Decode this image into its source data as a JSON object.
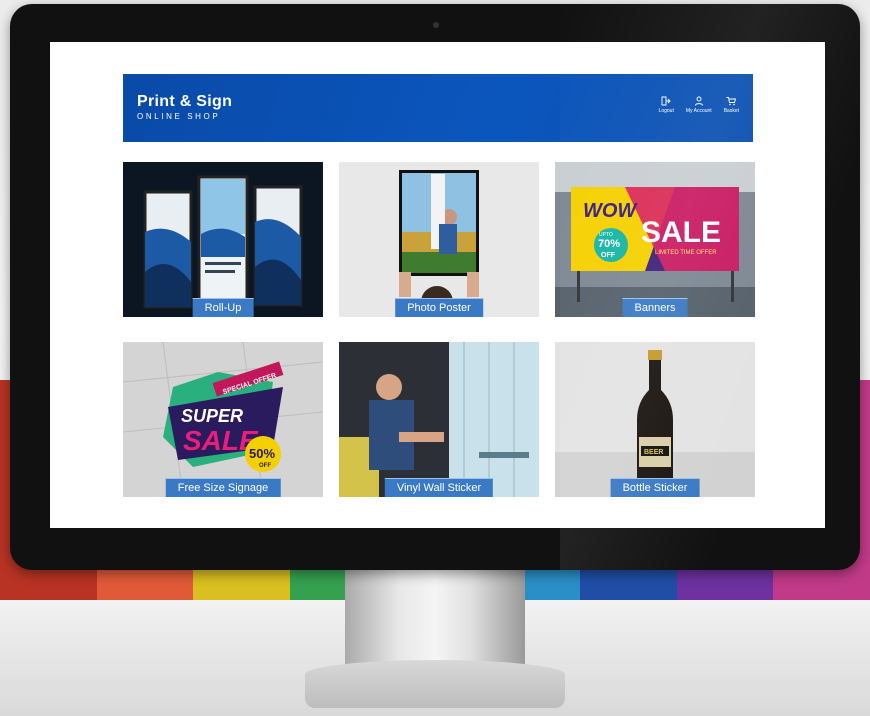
{
  "header": {
    "brand_title": "Print & Sign",
    "brand_subtitle": "ONLINE SHOP",
    "nav": [
      {
        "label": "Logout",
        "icon": "logout-icon"
      },
      {
        "label": "My Account",
        "icon": "user-icon"
      },
      {
        "label": "Basket",
        "icon": "cart-icon"
      }
    ]
  },
  "products": [
    {
      "label": "Roll-Up"
    },
    {
      "label": "Photo Poster"
    },
    {
      "label": "Banners"
    },
    {
      "label": "Free Size Signage"
    },
    {
      "label": "Vinyl Wall Sticker"
    },
    {
      "label": "Bottle Sticker"
    }
  ],
  "images": {
    "banner_main": "WOW",
    "banner_sale": "SALE",
    "banner_offer": "70%",
    "banner_offer_prefix": "UPTO",
    "banner_offer_suffix": "OFF",
    "banner_tagline": "LIMITED TIME OFFER",
    "signage_ribbon": "SPECIAL OFFER",
    "signage_super": "SUPER",
    "signage_sale": "SALE",
    "signage_pct": "50%",
    "signage_off": "OFF",
    "bottle_label": "BEER"
  },
  "colors": {
    "header_blue": "#0b56bd",
    "label_blue": "#3a79c4",
    "binder_colors": [
      "#c0392b",
      "#e84c3d",
      "#d8c318",
      "#2fa84f",
      "#1b8f6a",
      "#2a8dc5",
      "#1d4fa8",
      "#6b2fa3",
      "#c2358b"
    ]
  }
}
